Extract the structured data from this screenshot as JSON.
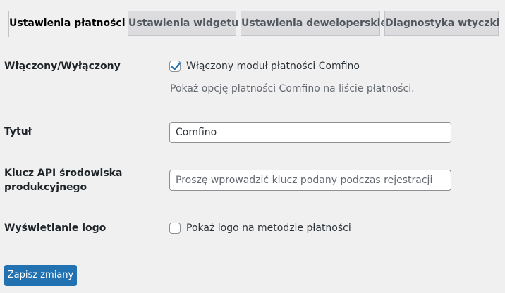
{
  "tabs": [
    {
      "label": "Ustawienia płatności",
      "active": true
    },
    {
      "label": "Ustawienia widgetu",
      "active": false
    },
    {
      "label": "Ustawienia deweloperskie",
      "active": false
    },
    {
      "label": "Diagnostyka wtyczki",
      "active": false
    }
  ],
  "fields": {
    "enabled": {
      "label": "Włączony/Wyłączony",
      "checkbox_label": "Włączony moduł płatności Comfino",
      "checked": true,
      "description": "Pokaż opcję płatności Comfino na liście płatności."
    },
    "title": {
      "label": "Tytuł",
      "value": "Comfino"
    },
    "api_key": {
      "label_line1": "Klucz API środowiska",
      "label_line2": "produkcyjnego",
      "value": "",
      "placeholder": "Proszę wprowadzić klucz podany podczas rejestracji"
    },
    "show_logo": {
      "label": "Wyświetlanie logo",
      "checkbox_label": "Pokaż logo na metodzie płatności",
      "checked": false
    }
  },
  "save_button_label": "Zapisz zmiany",
  "colors": {
    "primary": "#2271b1",
    "background": "#f0f0f1",
    "inactive_tab": "#dcdcde"
  },
  "icons": {
    "checkmark": "checkmark-icon"
  }
}
